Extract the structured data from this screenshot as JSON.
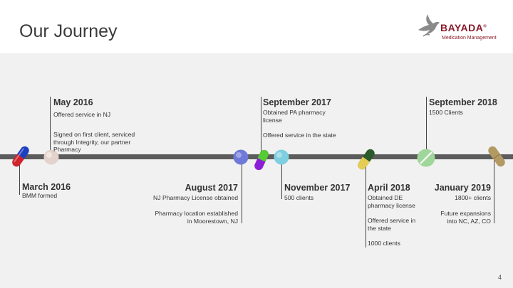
{
  "header": {
    "title": "Our Journey"
  },
  "logo": {
    "name": "BAYADA",
    "subtitle": "Medication Management",
    "trademark": "®"
  },
  "events": [
    {
      "title": "March 2016",
      "text": "BMM formed"
    },
    {
      "title": "May 2016",
      "p1": "Offered service in NJ",
      "p2": "Signed on first client, serviced through Integrity, our partner Pharmacy"
    },
    {
      "title": "August 2017",
      "p1": "NJ Pharmacy License obtained",
      "p2": "Pharmacy location established in Moorestown, NJ"
    },
    {
      "title": "September 2017",
      "p1": "Obtained PA pharmacy license",
      "p2": "Offered service in the state"
    },
    {
      "title": "November 2017",
      "text": "500 clients"
    },
    {
      "title": "April 2018",
      "p1": "Obtained DE pharmacy license",
      "p2": "Offered service in the state",
      "p3": "1000 clients"
    },
    {
      "title": "September 2018",
      "text": "1500 Clients"
    },
    {
      "title": "January 2019",
      "p1": "1800+ clients",
      "p2": "Future expansions into NC, AZ, CO"
    }
  ],
  "page_number": "4",
  "colors": {
    "logo": "#8a1c2b",
    "timeline": "#5c5c5c",
    "band": "#f1f1f1"
  }
}
